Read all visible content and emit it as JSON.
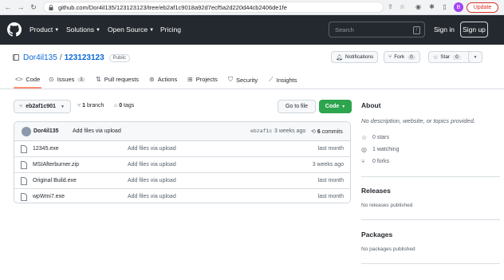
{
  "browser": {
    "url": "github.com/Dor4il135/123123123/tree/eb2af1c9018a92d7ecf5a2d220d44cb2406de1fe",
    "update_label": "Update",
    "profile_initial": "B"
  },
  "header": {
    "nav": [
      {
        "label": "Product"
      },
      {
        "label": "Solutions"
      },
      {
        "label": "Open Source"
      },
      {
        "label": "Pricing"
      }
    ],
    "search_placeholder": "Search",
    "search_shortcut": "/",
    "sign_in": "Sign in",
    "sign_up": "Sign up"
  },
  "repo": {
    "owner": "Dor4il135",
    "separator": "/",
    "name": "123123123",
    "visibility": "Public",
    "notifications_label": "Notifications",
    "fork_label": "Fork",
    "fork_count": "0",
    "star_label": "Star",
    "star_count": "0"
  },
  "tabs": [
    {
      "label": "Code"
    },
    {
      "label": "Issues",
      "count": "1"
    },
    {
      "label": "Pull requests"
    },
    {
      "label": "Actions"
    },
    {
      "label": "Projects"
    },
    {
      "label": "Security"
    },
    {
      "label": "Insights"
    }
  ],
  "branch": {
    "name": "eb2af1c901",
    "branches_count": "1",
    "branches_label": "branch",
    "tags_count": "0",
    "tags_label": "tags",
    "goto_file": "Go to file",
    "code_label": "Code"
  },
  "commit": {
    "author": "Dor4il135",
    "message": "Add files via upload",
    "sha": "ebzaf1c",
    "time": "3 weeks ago",
    "commits_count": "6",
    "commits_label": "commits"
  },
  "files": [
    {
      "name": "12345.exe",
      "message": "Add files via upload",
      "time": "last month"
    },
    {
      "name": "MSIAfterburner.zip",
      "message": "Add files via upload",
      "time": "3 weeks ago"
    },
    {
      "name": "Original Build.exe",
      "message": "Add files via upload",
      "time": "last month"
    },
    {
      "name": "wpWmi7.exe",
      "message": "Add files via upload",
      "time": "last month"
    }
  ],
  "about": {
    "heading": "About",
    "description": "No description, website, or topics provided.",
    "stars": "0 stars",
    "watching": "1 watching",
    "forks": "0 forks"
  },
  "releases": {
    "heading": "Releases",
    "subtext": "No releases published"
  },
  "packages": {
    "heading": "Packages",
    "subtext": "No packages published"
  }
}
